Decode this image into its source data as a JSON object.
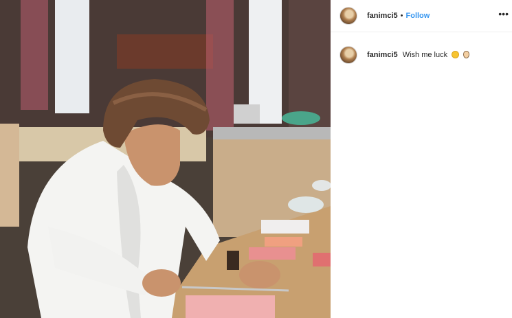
{
  "post": {
    "username": "fanimci5",
    "separator": "•",
    "follow_label": "Follow",
    "more_icon": "more-options-icon",
    "more_glyph": "•••"
  },
  "caption": {
    "username": "fanimci5",
    "text": "Wish me luck",
    "emojis": [
      "smiling-face-icon",
      "ok-hand-icon"
    ]
  }
}
